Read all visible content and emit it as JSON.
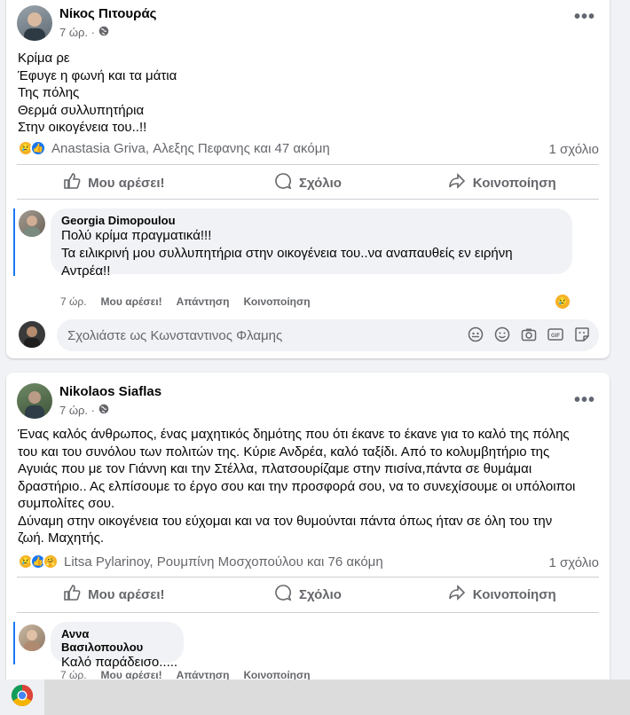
{
  "post1": {
    "author": "Νίκος Πιτουράς",
    "time": "7 ώρ. ·",
    "lines": [
      "Κρίμα  ρε",
      "Έφυγε  η φωνή και τα μάτια",
      "Της πόλης",
      "Θερμά συλλυπητήρια",
      "Στην οικογένεια  του..!!"
    ],
    "reactions_text": "Anastasia Griva, Αλεξης Πεφανης και 47 ακόμη",
    "comment_count": "1 σχόλιο",
    "comment": {
      "author": "Georgia Dimopoulou",
      "lines": [
        "Πολύ κρίμα πραγματικά!!!",
        "Τα ειλικρινή μου συλλυπητήρια στην οικογένεια του..να αναπαυθείς εν ειρήνη",
        "Αντρέα!!"
      ],
      "time": "7 ώρ."
    },
    "write_placeholder": "Σχολιάστε ως Κωνσταντινος Φλαμης"
  },
  "post2": {
    "author": "Nikolaos Siaflas",
    "time": "7 ώρ. ·",
    "lines": [
      "Ένας καλός άνθρωπος, ένας μαχητικός δημότης που ότι έκανε το έκανε για το καλό της πόλης",
      "του και του συνόλου των πολιτών της. Κύριε Ανδρέα, καλό ταξίδι. Από το κολυμβητήριο της",
      "Αγυιάς που με τον Γιάννη και την Στέλλα, πλατσουρίζαμε στην πισίνα,πάντα σε θυμάμαι",
      "δραστήριο.. Ας ελπίσουμε το έργο σου και την προσφορά σου, να το συνεχίσουμε οι υπόλοιποι",
      "συμπολίτες σου.",
      "Δύναμη στην οικογένεια του εύχομαι και να τον θυμούνται πάντα όπως ήταν σε όλη του την",
      "ζωή. Μαχητής."
    ],
    "reactions_text": "Litsa Pylarinoy, Ρουμπίνη Μοσχοπούλου και 76 ακόμη",
    "comment_count": "1 σχόλιο",
    "comment": {
      "author": "Αννα Βασιλοπουλου",
      "lines": [
        "Καλό παράδεισο....."
      ],
      "time": "7 ώρ."
    }
  },
  "actions": {
    "like": "Μου αρέσει!",
    "comment": "Σχόλιο",
    "share": "Κοινοποίηση",
    "c_like": "Μου αρέσει!",
    "c_reply": "Απάντηση",
    "c_share": "Κοινοποίηση"
  },
  "icons": [
    "globe-icon",
    "more-icon",
    "like-icon",
    "comment-icon",
    "share-icon",
    "sad-reaction-icon",
    "like-reaction-icon",
    "care-reaction-icon",
    "avatar-sticker-icon",
    "emoji-icon",
    "camera-icon",
    "gif-icon",
    "sticker-icon",
    "chrome-icon"
  ],
  "colors": {
    "accent": "#1877f2",
    "muted": "#65676b",
    "bubble": "#f0f2f5"
  }
}
